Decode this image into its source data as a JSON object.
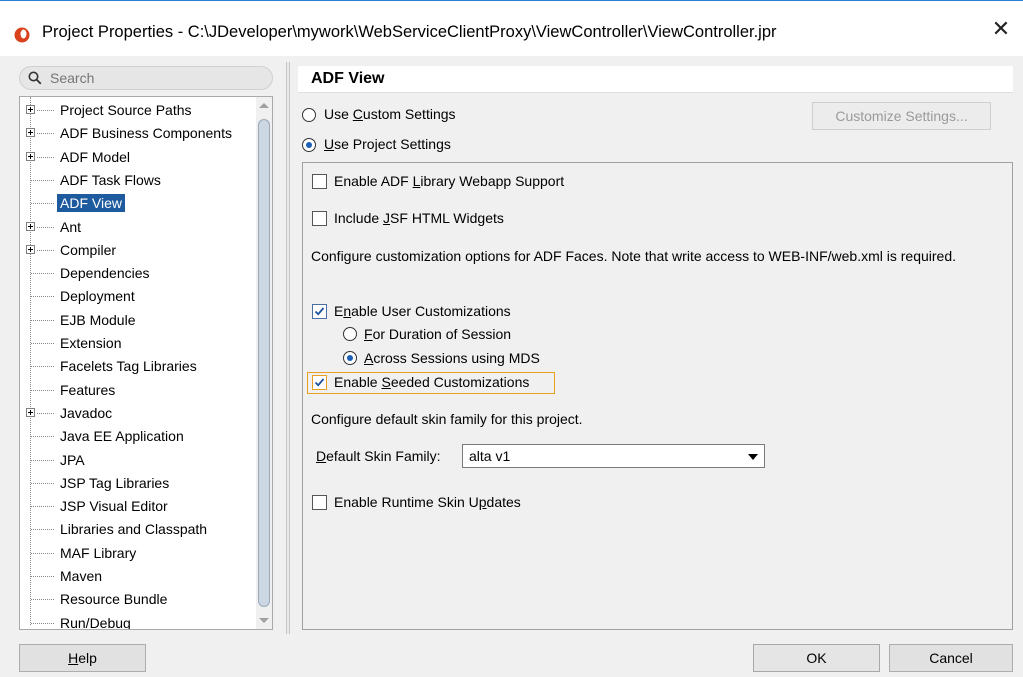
{
  "window": {
    "title": "Project Properties - C:\\JDeveloper\\mywork\\WebServiceClientProxy\\ViewController\\ViewController.jpr",
    "close_symbol": "✕"
  },
  "search": {
    "placeholder": "Search",
    "icon": "search-icon"
  },
  "tree": {
    "items": [
      {
        "label": "Project Source Paths",
        "expandable": true
      },
      {
        "label": "ADF Business Components",
        "expandable": true
      },
      {
        "label": "ADF Model",
        "expandable": true
      },
      {
        "label": "ADF Task Flows",
        "expandable": false
      },
      {
        "label": "ADF View",
        "expandable": false,
        "selected": true
      },
      {
        "label": "Ant",
        "expandable": true
      },
      {
        "label": "Compiler",
        "expandable": true
      },
      {
        "label": "Dependencies",
        "expandable": false
      },
      {
        "label": "Deployment",
        "expandable": false
      },
      {
        "label": "EJB Module",
        "expandable": false
      },
      {
        "label": "Extension",
        "expandable": false
      },
      {
        "label": "Facelets Tag Libraries",
        "expandable": false
      },
      {
        "label": "Features",
        "expandable": false
      },
      {
        "label": "Javadoc",
        "expandable": true
      },
      {
        "label": "Java EE Application",
        "expandable": false
      },
      {
        "label": "JPA",
        "expandable": false
      },
      {
        "label": "JSP Tag Libraries",
        "expandable": false
      },
      {
        "label": "JSP Visual Editor",
        "expandable": false
      },
      {
        "label": "Libraries and Classpath",
        "expandable": false
      },
      {
        "label": "MAF Library",
        "expandable": false
      },
      {
        "label": "Maven",
        "expandable": false
      },
      {
        "label": "Resource Bundle",
        "expandable": false
      },
      {
        "label": "Run/Debug",
        "expandable": false
      }
    ]
  },
  "panel": {
    "title": "ADF View",
    "use_custom_settings": "Use Custom Settings",
    "use_project_settings": "Use Project Settings",
    "customize_settings_button": "Customize Settings...",
    "settings_mode": "project",
    "enable_adf_library": {
      "label": "Enable ADF Library Webapp Support",
      "checked": false
    },
    "include_jsf_html": {
      "label": "Include JSF HTML Widgets",
      "checked": false
    },
    "customization_note": "Configure customization options for ADF Faces. Note that write access to WEB-INF/web.xml is required.",
    "enable_user_customizations": {
      "label": "Enable User Customizations",
      "checked": true
    },
    "for_duration_of_session": "For Duration of Session",
    "across_sessions_mds": "Across Sessions using MDS",
    "customization_scope": "across_sessions",
    "enable_seeded_customizations": {
      "label": "Enable Seeded Customizations",
      "checked": true
    },
    "skin_note": "Configure default skin family for this project.",
    "default_skin_family_label": "Default Skin Family:",
    "default_skin_family_value": "alta v1",
    "enable_runtime_skin_updates": {
      "label": "Enable Runtime Skin Updates",
      "checked": false
    }
  },
  "footer": {
    "help_button": "Help",
    "ok_button": "OK",
    "cancel_button": "Cancel"
  },
  "colors": {
    "selection": "#1e5a9e",
    "focus_ring": "#e8a020",
    "radio_dot": "#1c5fb8",
    "app_icon": "#d9421c"
  }
}
